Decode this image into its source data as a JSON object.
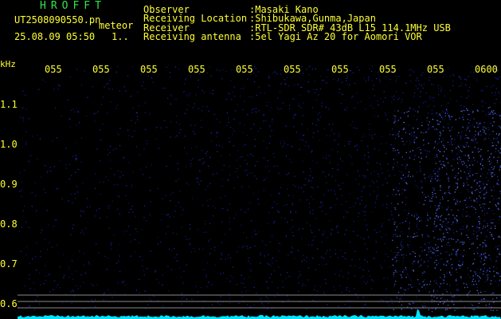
{
  "header": {
    "app_title": "HROFFT",
    "file_name": "UT2508090550.pn",
    "meteor_label": "meteor",
    "date_time": "25.08.09 05:50",
    "count": "1..",
    "meta": [
      {
        "key": "Observer",
        "value": ":Masaki Kano"
      },
      {
        "key": "Receiving Location",
        "value": ":Shibukawa,Gunma,Japan"
      },
      {
        "key": "Receiver",
        "value": ":RTL-SDR SDR# 43dB L15 114.1MHz USB"
      },
      {
        "key": "Receiving antenna",
        "value": ":5el Yagi Az 20 for Aomori VOR"
      }
    ]
  },
  "spectrogram": {
    "y_unit": "kHz",
    "x_ticks": [
      "055",
      "055",
      "055",
      "055",
      "055",
      "055",
      "055",
      "055",
      "055",
      "0600"
    ],
    "y_ticks": [
      "1.1",
      "1.0",
      "0.9",
      "0.8",
      "0.7",
      "0.6"
    ],
    "colors": {
      "background": "#000000",
      "noise": "#1a20a0",
      "baseline": "#00e5ff",
      "text": "#ffff33",
      "title": "#2ee84a"
    }
  }
}
